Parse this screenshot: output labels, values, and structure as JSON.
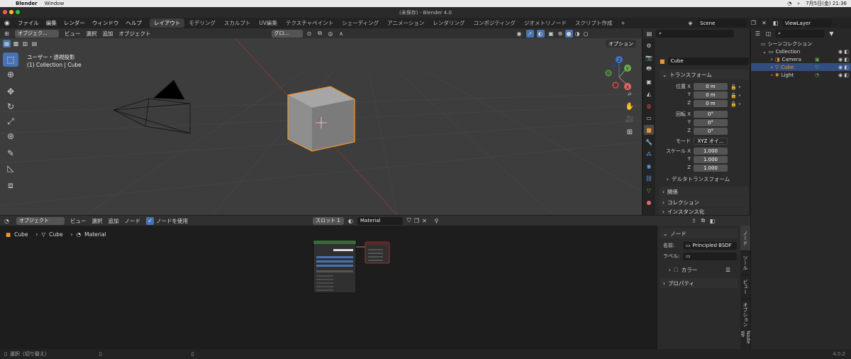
{
  "macbar": {
    "app": "Blender",
    "menus": [
      "Window"
    ],
    "datetime": "7月5日(金) 21:36"
  },
  "window": {
    "title": "(未保存) - Blender 4.0"
  },
  "topbar": {
    "menus": [
      "ファイル",
      "編集",
      "レンダー",
      "ウィンドウ",
      "ヘルプ"
    ],
    "workspaces": [
      "レイアウト",
      "モデリング",
      "スカルプト",
      "UV編集",
      "テクスチャペイント",
      "シェーディング",
      "アニメーション",
      "レンダリング",
      "コンポジティング",
      "ジオメトリノード",
      "スクリプト作成"
    ],
    "active_workspace": "レイアウト",
    "add_tab": "+",
    "scene": "Scene",
    "view_layer": "ViewLayer"
  },
  "viewport": {
    "mode": "オブジェク...",
    "menus": [
      "ビュー",
      "選択",
      "追加",
      "オブジェクト"
    ],
    "transform_orient": "グロ...",
    "view_label": "ユーザー・透視投影",
    "collection_label": "(1) Collection | Cube",
    "options": "オプション",
    "gizmo": {
      "x": "X",
      "y": "Y",
      "z": "Z"
    }
  },
  "properties": {
    "object_name": "Cube",
    "transform_section": "トランスフォーム",
    "location_label": "位置 X",
    "rotation_label": "回転 X",
    "scale_label": "スケール X",
    "y_label": "Y",
    "z_label": "Z",
    "location": [
      "0 m",
      "0 m",
      "0 m"
    ],
    "rotation": [
      "0°",
      "0°",
      "0°"
    ],
    "mode_label": "モード",
    "mode_value": "XYZ オイ...",
    "scale": [
      "1.000",
      "1.000",
      "1.000"
    ],
    "sub_sections": [
      "デルタトランスフォーム"
    ],
    "collapsed_sections": [
      "関係",
      "コレクション",
      "インスタンス化"
    ]
  },
  "outliner": {
    "root": "シーンコレクション",
    "items": [
      {
        "name": "Collection"
      },
      {
        "name": "Camera"
      },
      {
        "name": "Cube"
      },
      {
        "name": "Light"
      }
    ]
  },
  "node_editor": {
    "mode": "オブジェクト",
    "menus": [
      "ビュー",
      "選択",
      "追加",
      "ノード"
    ],
    "use_nodes_label": "ノードを使用",
    "slot": "スロット 1",
    "material": "Material",
    "breadcrumb": [
      "Cube",
      "Cube",
      "Material"
    ],
    "sidebar": {
      "section": "ノード",
      "name_label": "名前:",
      "name_value": "Principled BSDF",
      "label_label": "ラベル:",
      "color_section": "カラー",
      "props_section": "プロパティ"
    },
    "vtabs": [
      "ノード",
      "ツール",
      "ビュー",
      "オプション",
      "Node Wr"
    ]
  },
  "status": {
    "select": "選択（切り替え）",
    "version": "4.0.2"
  }
}
